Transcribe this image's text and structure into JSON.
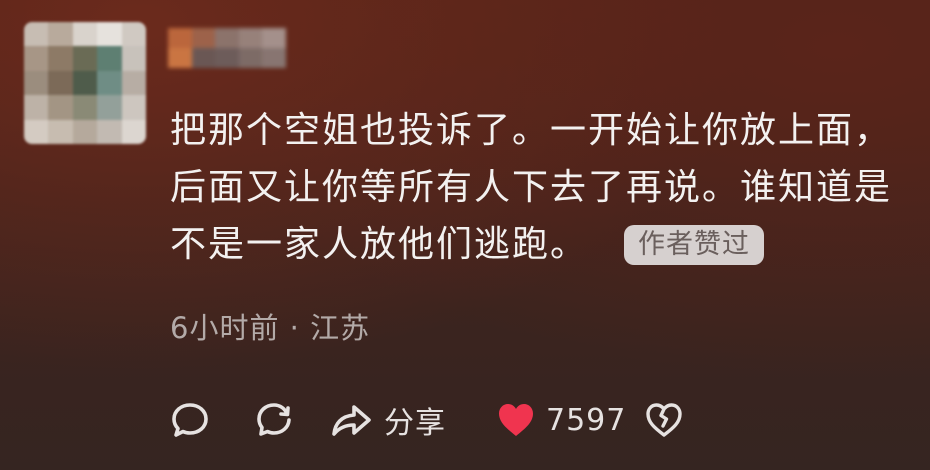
{
  "comment": {
    "avatar": {
      "icon": "blurred-avatar-icon",
      "pixels": [
        "#c7bdb3",
        "#b8aa9c",
        "#d9d3cc",
        "#e6e2dd",
        "#d0c9c2",
        "#a79686",
        "#8d7a66",
        "#6a6b55",
        "#5e7f72",
        "#c8c2bb",
        "#9b8d7e",
        "#7c6a58",
        "#4f5c4b",
        "#6f8d85",
        "#b7ada4",
        "#bdb2a7",
        "#a39584",
        "#8a8a76",
        "#93a09a",
        "#cdc6bf",
        "#d4cbc2",
        "#c7bcb0",
        "#b5a99c",
        "#c2bab2",
        "#dcd6d0"
      ]
    },
    "username": {
      "icon": "blurred-username-icon",
      "pixels": [
        "#c06a3e",
        "#a0664d",
        "#8e7770",
        "#9a8680",
        "#a89691",
        "#d07a45",
        "#6b5a58",
        "#6e5f5e",
        "#7f6f6b",
        "#8a7a76"
      ]
    },
    "text": "把那个空姐也投诉了。一开始让你放上面，后面又让你等所有人下去了再说。谁知道是不是一家人放他们逃跑。",
    "badge": "作者赞过",
    "meta": "6小时前 · 江苏"
  },
  "actions": {
    "reply_icon": "comment-bubble-icon",
    "repost_icon": "repost-bubble-icon",
    "share_icon": "share-arrow-icon",
    "share_label": "分享",
    "like_icon": "heart-filled-icon",
    "like_count": "7597",
    "like_color": "#f0344f",
    "dislike_icon": "broken-heart-icon"
  }
}
